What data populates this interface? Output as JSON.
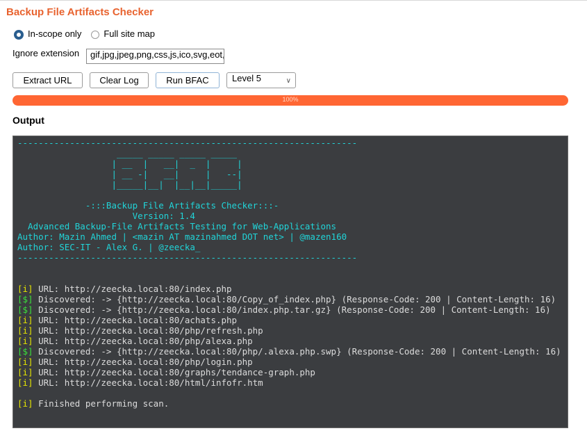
{
  "title": "Backup File Artifacts Checker",
  "scope": {
    "options": [
      {
        "label": "In-scope only",
        "selected": true
      },
      {
        "label": "Full site map",
        "selected": false
      }
    ]
  },
  "ignore_extension": {
    "label": "Ignore extension",
    "value": "gif,jpg,jpeg,png,css,js,ico,svg,eot,woff,ttf"
  },
  "buttons": {
    "extract": "Extract URL",
    "clear": "Clear Log",
    "run": "Run BFAC"
  },
  "level_select": {
    "value": "Level 5",
    "icon": "chevron-down-icon"
  },
  "progress": {
    "percent": 100,
    "label": "100%",
    "color": "#ff6633"
  },
  "output_label": "Output",
  "colors": {
    "accent": "#e8632f",
    "terminal_bg": "#3b3d40",
    "banner": "#21d4d8",
    "info": "#e6e600",
    "found": "#3ae03a"
  },
  "terminal": {
    "banner": [
      "-----------------------------------------------------------------",
      "                   _____ _____ _____ _____ ",
      "                  | __  |   __|  _  |     |",
      "                  | __ -|   __|     |   --|",
      "                  |_____|__|  |__|__|_____|",
      "",
      "             -:::Backup File Artifacts Checker:::-",
      "                      Version: 1.4",
      "  Advanced Backup-File Artifacts Testing for Web-Applications",
      "Author: Mazin Ahmed | <mazin AT mazinahmed DOT net> | @mazen160",
      "Author: SEC-IT - Alex G. | @zeecka_",
      "-----------------------------------------------------------------",
      "",
      ""
    ],
    "log": [
      {
        "tag": "[i]",
        "type": "info",
        "text": " URL: http://zeecka.local:80/index.php"
      },
      {
        "tag": "[$]",
        "type": "found",
        "text": " Discovered: -> {http://zeecka.local:80/Copy_of_index.php} (Response-Code: 200 | Content-Length: 16)"
      },
      {
        "tag": "[$]",
        "type": "found",
        "text": " Discovered: -> {http://zeecka.local:80/index.php.tar.gz} (Response-Code: 200 | Content-Length: 16)"
      },
      {
        "tag": "[i]",
        "type": "info",
        "text": " URL: http://zeecka.local:80/achats.php"
      },
      {
        "tag": "[i]",
        "type": "info",
        "text": " URL: http://zeecka.local:80/php/refresh.php"
      },
      {
        "tag": "[i]",
        "type": "info",
        "text": " URL: http://zeecka.local:80/php/alexa.php"
      },
      {
        "tag": "[$]",
        "type": "found",
        "text": " Discovered: -> {http://zeecka.local:80/php/.alexa.php.swp} (Response-Code: 200 | Content-Length: 16)"
      },
      {
        "tag": "[i]",
        "type": "info",
        "text": " URL: http://zeecka.local:80/php/login.php"
      },
      {
        "tag": "[i]",
        "type": "info",
        "text": " URL: http://zeecka.local:80/graphs/tendance-graph.php"
      },
      {
        "tag": "[i]",
        "type": "info",
        "text": " URL: http://zeecka.local:80/html/infofr.htm"
      },
      {
        "tag": "",
        "type": "blank",
        "text": ""
      },
      {
        "tag": "[i]",
        "type": "info",
        "text": " Finished performing scan."
      }
    ]
  }
}
